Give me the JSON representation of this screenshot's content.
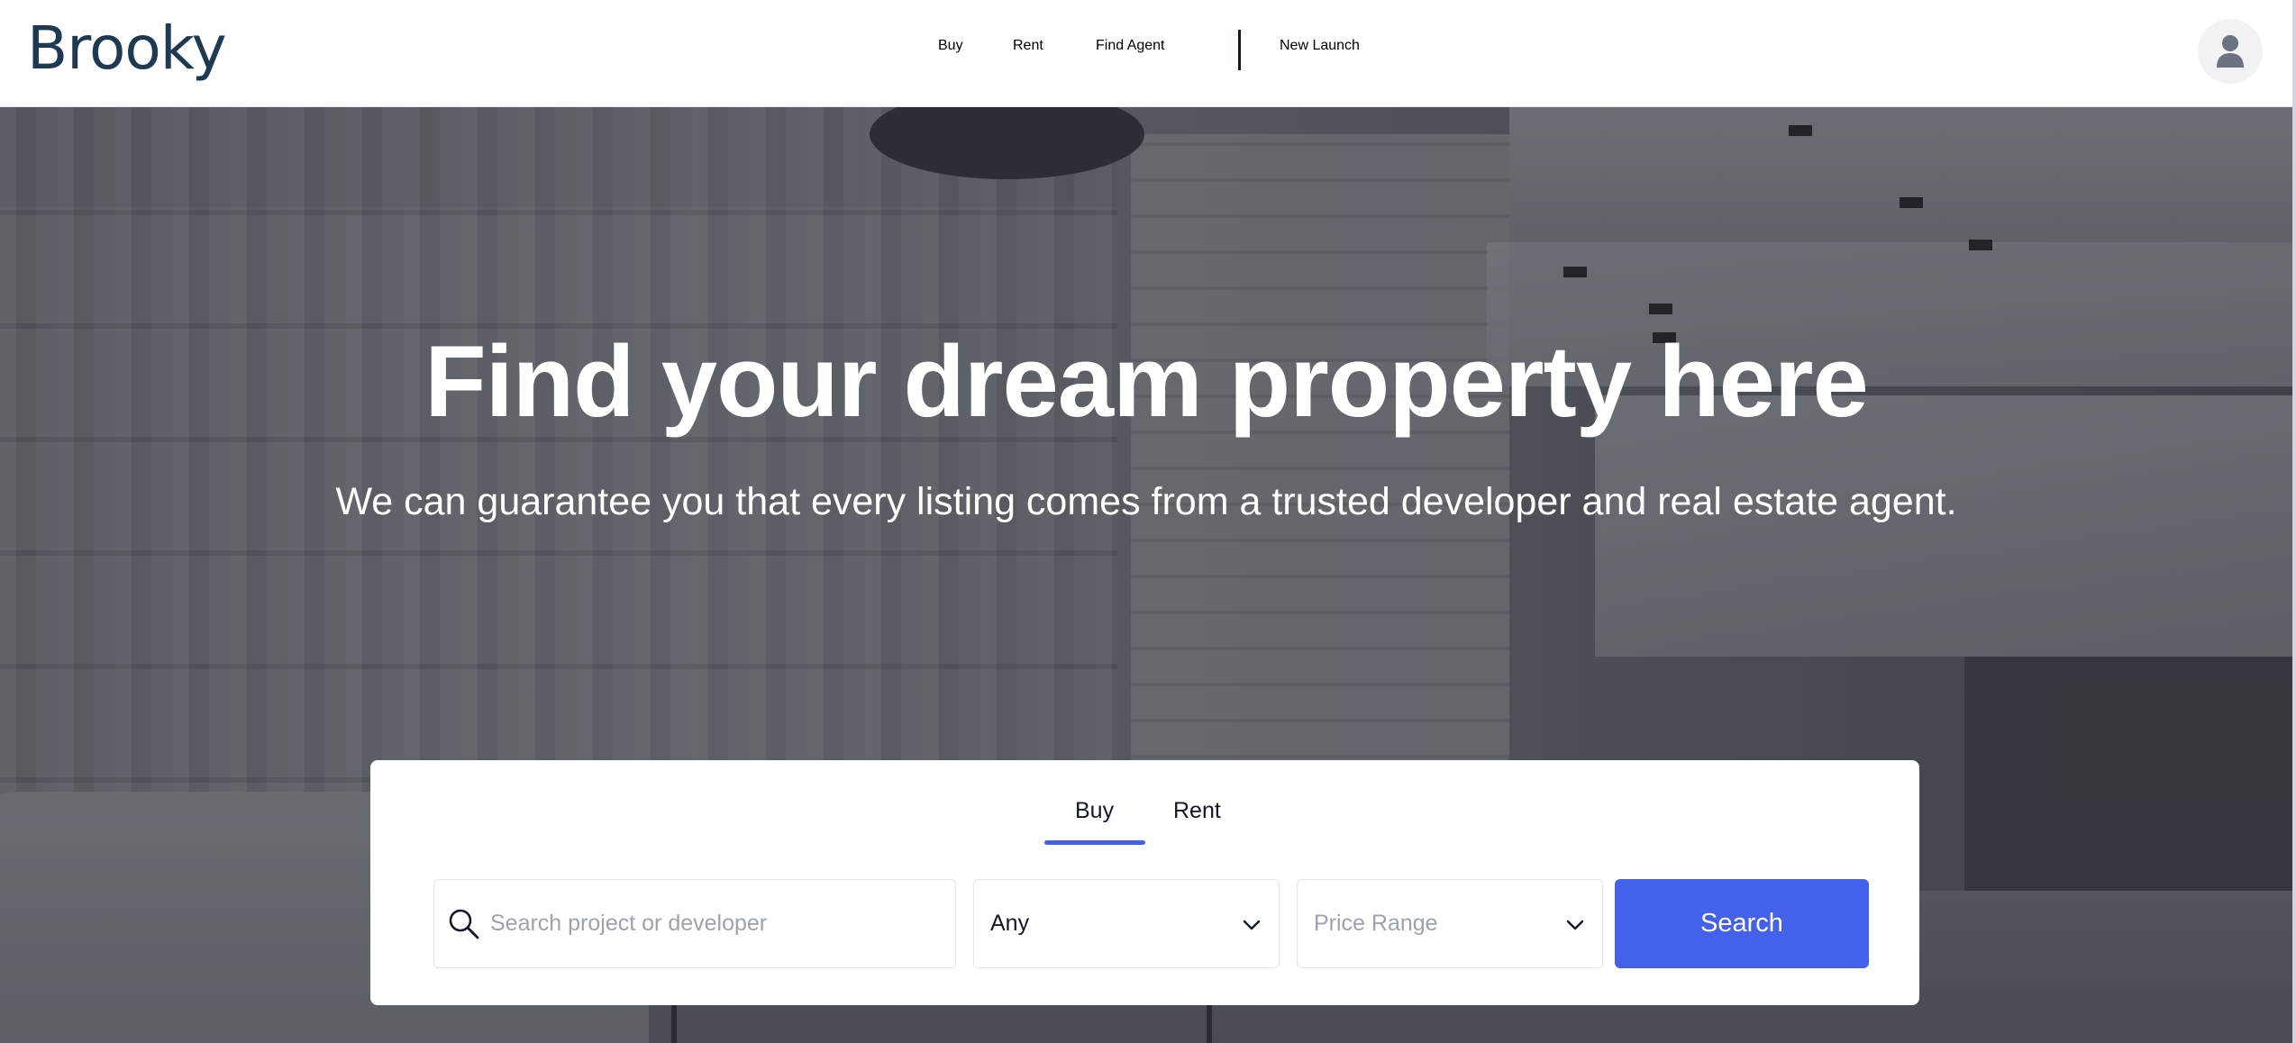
{
  "header": {
    "logo_text": "Brooky",
    "nav": {
      "buy": "Buy",
      "rent": "Rent",
      "find_agent": "Find Agent",
      "new_launch": "New Launch"
    }
  },
  "hero": {
    "title": "Find your dream property here",
    "subtitle": "We can guarantee you that every listing comes from a trusted developer and real estate agent."
  },
  "search_card": {
    "tabs": [
      "Buy",
      "Rent"
    ],
    "active_tab": "Buy",
    "search_placeholder": "Search project or developer",
    "property_type_value": "Any",
    "price_range_placeholder": "Price Range",
    "search_button_label": "Search"
  },
  "colors": {
    "brand": "#1d3a52",
    "accent": "#4461ec"
  },
  "icons": {
    "search": "magnifier",
    "dropdown": "chevron-down",
    "user": "user-silhouette"
  }
}
